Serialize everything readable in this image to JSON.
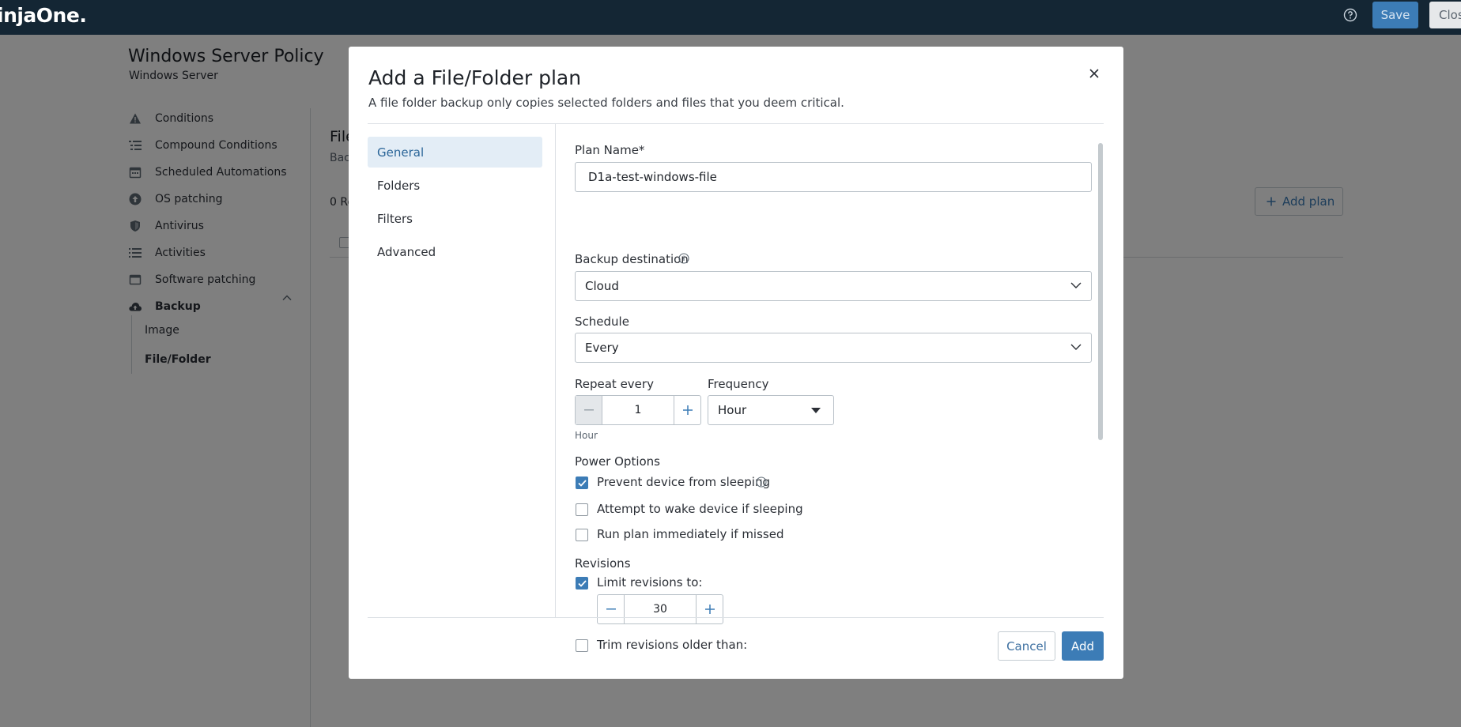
{
  "topbar": {
    "logo_text": "injaOne.",
    "help_icon": "help-circle-icon",
    "save_label": "Save",
    "close_label": "Clos"
  },
  "page": {
    "title": "Windows Server Policy",
    "subtitle": "Windows Server",
    "sidebar": {
      "items": [
        {
          "label": "Conditions",
          "icon": "warning-icon"
        },
        {
          "label": "Compound Conditions",
          "icon": "list-tree-icon"
        },
        {
          "label": "Scheduled Automations",
          "icon": "calendar-icon"
        },
        {
          "label": "OS patching",
          "icon": "upload-circle-icon"
        },
        {
          "label": "Antivirus",
          "icon": "shield-icon"
        },
        {
          "label": "Activities",
          "icon": "list-icon"
        },
        {
          "label": "Software patching",
          "icon": "window-icon"
        },
        {
          "label": "Backup",
          "icon": "cloud-upload-icon"
        }
      ],
      "backup_subitems": [
        "Image",
        "File/Folder"
      ]
    },
    "content": {
      "title_fragment": "File",
      "subtitle_fragment": "Bac",
      "count_fragment": "0 Re",
      "add_plan_label": "Add plan"
    }
  },
  "modal": {
    "title": "Add a File/Folder plan",
    "description": "A file folder backup only copies selected folders and files that you deem critical.",
    "tabs": [
      "General",
      "Folders",
      "Filters",
      "Advanced"
    ],
    "active_tab": "General",
    "form": {
      "plan_name_label": "Plan Name*",
      "plan_name_value": "D1a-test-windows-file",
      "backup_destination_label": "Backup destination",
      "backup_destination_value": "Cloud",
      "schedule_label": "Schedule",
      "schedule_value": "Every",
      "repeat_every_label": "Repeat every",
      "repeat_every_value": "1",
      "repeat_hint": "Hour",
      "frequency_label": "Frequency",
      "frequency_value": "Hour",
      "power_options_label": "Power Options",
      "power_options": [
        {
          "label": "Prevent device from sleeping",
          "checked": true
        },
        {
          "label": "Attempt to wake device if sleeping",
          "checked": false
        },
        {
          "label": "Run plan immediately if missed",
          "checked": false
        }
      ],
      "revisions_label": "Revisions",
      "limit_revisions_label": "Limit revisions to:",
      "limit_revisions_checked": true,
      "limit_revisions_value": "30",
      "trim_revisions_label": "Trim revisions older than:",
      "trim_revisions_checked": false
    },
    "cancel_label": "Cancel",
    "add_label": "Add"
  },
  "colors": {
    "topbar": "#142634",
    "primary": "#3c7cb6",
    "overlay": "rgba(0,0,0,0.5)",
    "active_tab_bg": "#e3edf6"
  }
}
